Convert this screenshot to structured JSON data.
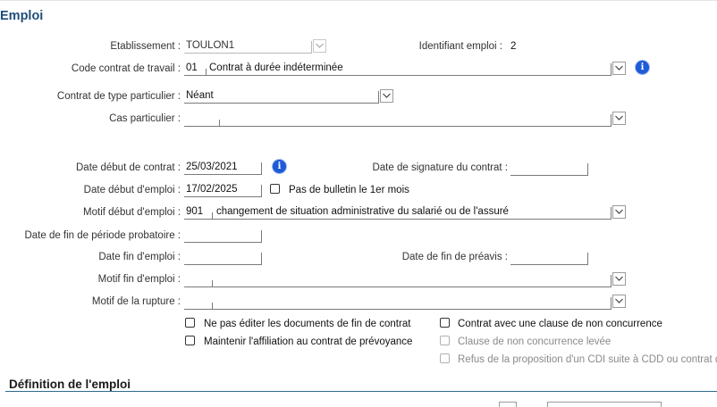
{
  "section": {
    "title": "Emploi"
  },
  "etablissement": {
    "label": "Etablissement :",
    "value": "TOULON1"
  },
  "identifiant": {
    "label": "Identifiant emploi :",
    "value": "2"
  },
  "code_contrat": {
    "label": "Code contrat de travail :",
    "code": "01",
    "text": "Contrat à durée indéterminée"
  },
  "contrat_particulier": {
    "label": "Contrat de type particulier :",
    "value": "Néant"
  },
  "cas_particulier": {
    "label": "Cas particulier :",
    "value": ""
  },
  "date_debut_contrat": {
    "label": "Date début de contrat :",
    "value": "25/03/2021"
  },
  "date_signature": {
    "label": "Date de signature du contrat :",
    "value": ""
  },
  "date_debut_emploi": {
    "label": "Date début d'emploi :",
    "value": "17/02/2025"
  },
  "pas_bulletin": {
    "label": "Pas de bulletin le 1er mois",
    "checked": false
  },
  "motif_debut": {
    "label": "Motif début d'emploi :",
    "code": "901",
    "text": "changement de situation administrative du salarié ou de l'assuré"
  },
  "date_fin_probatoire": {
    "label": "Date de fin de période probatoire :",
    "value": ""
  },
  "date_fin_emploi": {
    "label": "Date fin d'emploi :",
    "value": ""
  },
  "date_fin_preavis": {
    "label": "Date de fin de préavis :",
    "value": ""
  },
  "motif_fin": {
    "label": "Motif fin d'emploi :",
    "value": ""
  },
  "motif_rupture": {
    "label": "Motif de la rupture :",
    "value": ""
  },
  "checkboxes": {
    "ne_pas_editer": {
      "label": "Ne pas éditer les documents de fin de contrat",
      "checked": false
    },
    "maintenir": {
      "label": "Maintenir l'affiliation au contrat de prévoyance",
      "checked": false
    },
    "clause_nc": {
      "label": "Contrat avec une clause de non concurrence",
      "checked": false
    },
    "clause_levee": {
      "label": "Clause de non concurrence levée",
      "checked": false,
      "disabled": true
    },
    "refus_cdi": {
      "label": "Refus de la proposition d'un CDI suite à CDD ou contrat de m",
      "checked": false,
      "disabled": true
    }
  },
  "section2": {
    "title": "Définition de l'emploi"
  },
  "colors": {
    "accent": "#1f4e79",
    "info": "#1e5bd8"
  }
}
